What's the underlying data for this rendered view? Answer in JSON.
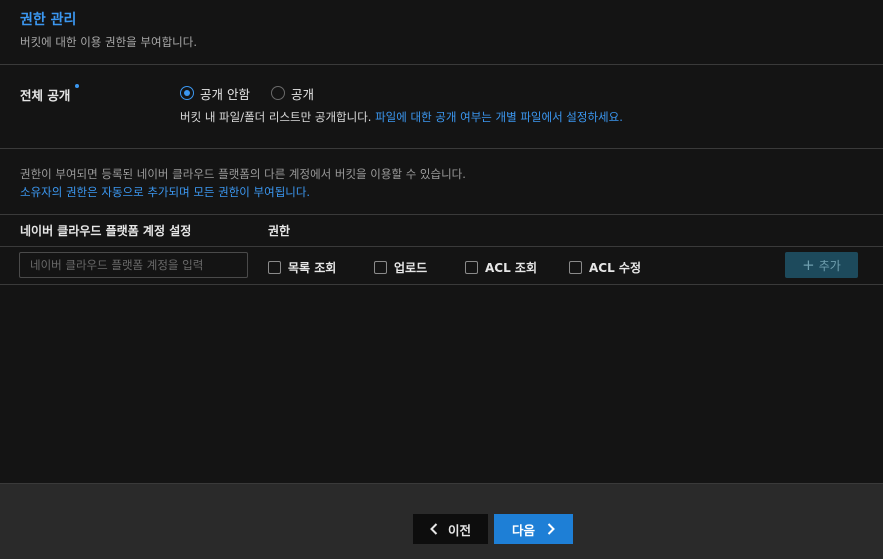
{
  "header": {
    "title": "권한 관리",
    "description": "버킷에 대한 이용 권한을 부여합니다."
  },
  "public_access": {
    "label": "전체 공개",
    "required": true,
    "options": [
      {
        "label": "공개 안함",
        "selected": true
      },
      {
        "label": "공개",
        "selected": false
      }
    ],
    "note_prefix": "버킷 내 파일/폴더 리스트만 공개합니다.",
    "note_highlight": "파일에 대한 공개 여부는 개별 파일에서 설정하세요."
  },
  "info": {
    "line1": "권한이 부여되면 등록된 네이버 클라우드 플랫폼의 다른 계정에서 버킷을 이용할 수 있습니다.",
    "line2": "소유자의 권한은 자동으로 추가되며 모든 권한이 부여됩니다."
  },
  "permissions_table": {
    "columns": [
      "네이버 클라우드 플랫폼 계정 설정",
      "권한"
    ],
    "account_input": {
      "value": "",
      "placeholder": "네이버 클라우드 플랫폼 계정을 입력"
    },
    "checkboxes": [
      {
        "label": "목록 조회",
        "checked": false
      },
      {
        "label": "업로드",
        "checked": false
      },
      {
        "label": "ACL 조회",
        "checked": false
      },
      {
        "label": "ACL 수정",
        "checked": false
      }
    ],
    "add_button": {
      "label": "추가",
      "icon": "plus-icon"
    }
  },
  "footer": {
    "prev_label": "이전",
    "next_label": "다음"
  },
  "colors": {
    "accent": "#3b97f0",
    "primary_button": "#1e7fd6",
    "add_button_disabled": "#1d4a5c",
    "background": "#141414",
    "footer_background": "#2a2a2a"
  }
}
